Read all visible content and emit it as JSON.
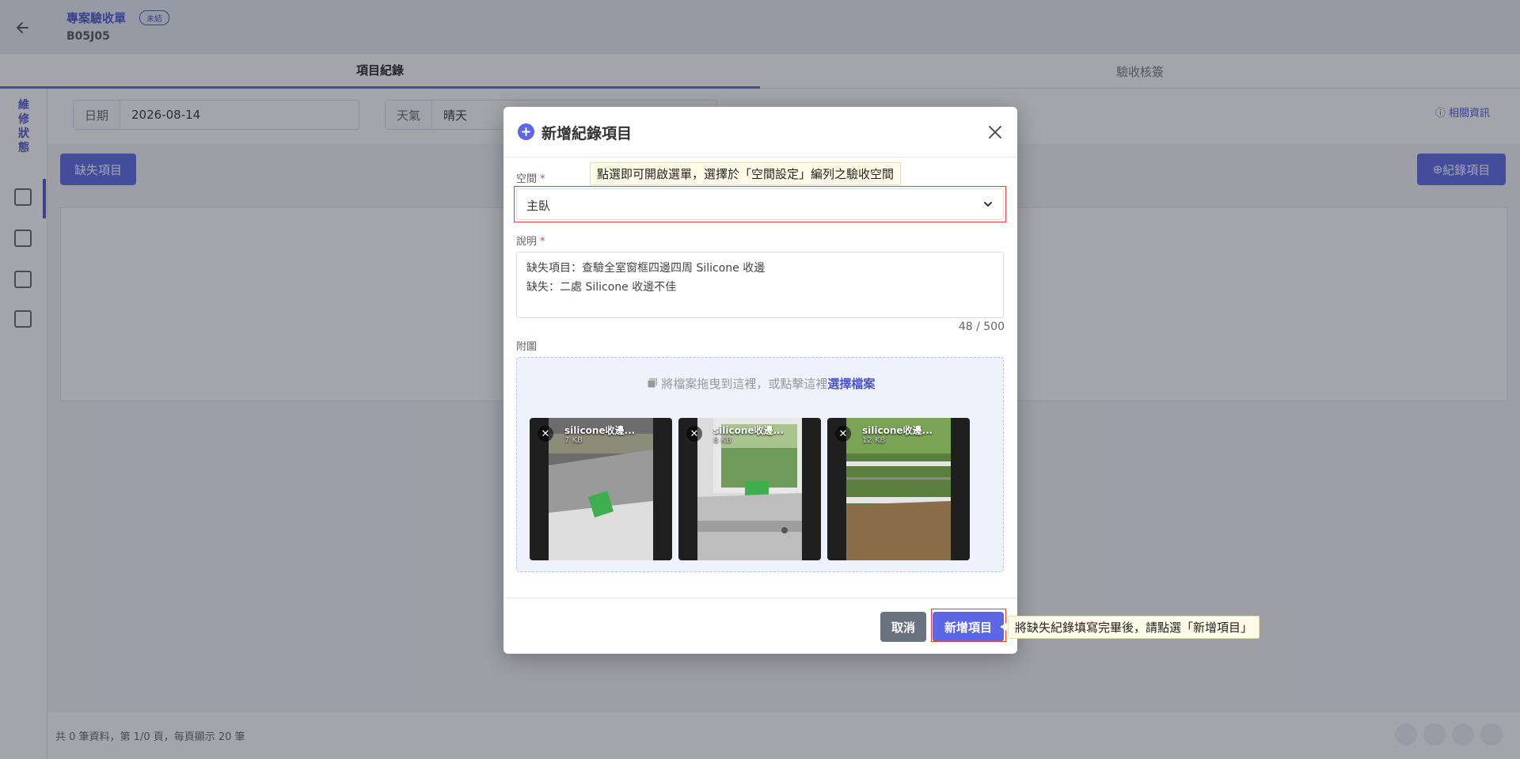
{
  "header": {
    "project_name": "專案驗收單",
    "badge": "未結",
    "project_code": "B05J05"
  },
  "tabs": [
    {
      "label": "項目紀錄",
      "active": true
    },
    {
      "label": "驗收核簽",
      "active": false
    }
  ],
  "leftnav": {
    "label": "維修狀態",
    "icons": [
      "calendar-icon",
      "document-icon",
      "archive-icon",
      "checklist-icon"
    ]
  },
  "filters": {
    "date_label": "日期",
    "date_value": "2026-08-14",
    "weather_label": "天氣",
    "weather_value": "晴天",
    "related_info": "相關資訊"
  },
  "actions": {
    "defect_button": "缺失項目",
    "record_button": "紀錄項目"
  },
  "footer": {
    "summary": "共 0 筆資料，第 1/0 頁，每頁顯示 20 筆"
  },
  "modal": {
    "title": "新增紀錄項目",
    "space_label": "空間",
    "space_value": "主臥",
    "description_label": "說明",
    "description_value": "缺失項目：查驗全室窗框四邊四周 Silicone 收邊\n缺失：二處 Silicone 收邊不佳",
    "char_counter": "48 / 500",
    "attachment_label": "附圖",
    "dropzone_text": "將檔案拖曳到這裡，或點擊這裡",
    "dropzone_link": "選擇檔案",
    "attachments": [
      {
        "name": "silicone收邊...",
        "size": "7 KB"
      },
      {
        "name": "silicone收邊...",
        "size": "8 KB"
      },
      {
        "name": "silicone收邊...",
        "size": "12 KB"
      }
    ],
    "cancel_button": "取消",
    "submit_button": "新增項目"
  },
  "annotations": {
    "space_tip": "點選即可開啟選單，選擇於「空間設定」編列之驗收空間",
    "submit_tip": "將缺失紀錄填寫完畢後，請點選「新增項目」"
  },
  "colors": {
    "accent": "#5c67e6",
    "highlight": "#e83b3b",
    "tooltip_bg": "#fffbe6"
  }
}
